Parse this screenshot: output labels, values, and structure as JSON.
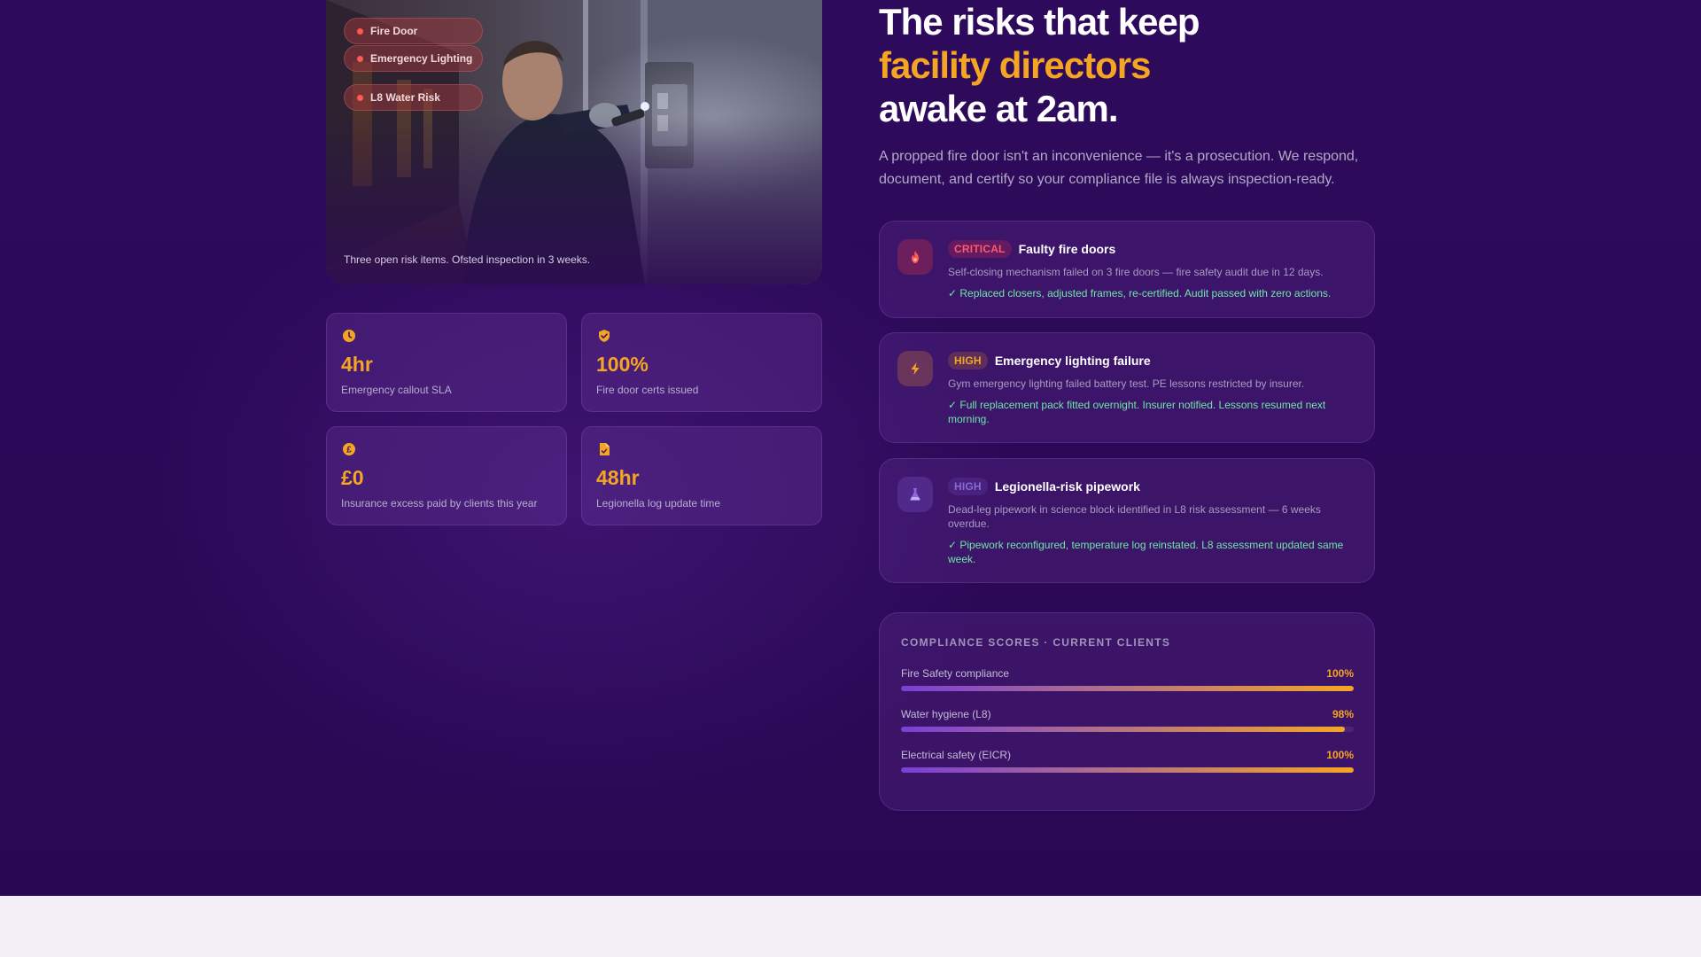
{
  "photo": {
    "tags": [
      "Fire Door",
      "Emergency Lighting",
      "L8 Water Risk"
    ],
    "caption": "Three open risk items. Ofsted inspection in 3 weeks."
  },
  "stats": [
    {
      "icon": "clock-icon",
      "value": "4hr",
      "label": "Emergency callout SLA"
    },
    {
      "icon": "shield-check-icon",
      "value": "100%",
      "label": "Fire door certs issued"
    },
    {
      "icon": "pound-coin-icon",
      "value": "£0",
      "label": "Insurance excess paid by clients this year"
    },
    {
      "icon": "document-icon",
      "value": "48hr",
      "label": "Legionella log update time"
    }
  ],
  "heading": {
    "line1": "The risks that keep",
    "line2": "facility directors",
    "line3": "awake at 2am.",
    "lead": "A propped fire door isn't an inconvenience — it's a prosecution. We respond, document, and certify so your compliance file is always inspection-ready."
  },
  "risks": [
    {
      "icon": "flame-icon",
      "badge": "CRITICAL",
      "title": "Faulty fire doors",
      "description": "Self-closing mechanism failed on 3 fire doors — fire safety audit due in 12 days.",
      "resolution": "✓ Replaced closers, adjusted frames, re-certified. Audit passed with zero actions."
    },
    {
      "icon": "lightning-icon",
      "badge": "HIGH",
      "title": "Emergency lighting failure",
      "description": "Gym emergency lighting failed battery test. PE lessons restricted by insurer.",
      "resolution": "✓ Full replacement pack fitted overnight. Insurer notified. Lessons resumed next morning."
    },
    {
      "icon": "flask-icon",
      "badge": "HIGH",
      "title": "Legionella-risk pipework",
      "description": "Dead-leg pipework in science block identified in L8 risk assessment — 6 weeks overdue.",
      "resolution": "✓ Pipework reconfigured, temperature log reinstated. L8 assessment updated same week."
    }
  ],
  "compliance": {
    "heading": "COMPLIANCE SCORES · CURRENT CLIENTS",
    "rows": [
      {
        "label": "Fire Safety compliance",
        "value": "100%",
        "fraction": 1.0
      },
      {
        "label": "Water hygiene (L8)",
        "value": "98%",
        "fraction": 0.98
      },
      {
        "label": "Electrical safety (EICR)",
        "value": "100%",
        "fraction": 1.0
      }
    ]
  },
  "colors": {
    "background": "#2e0a5c",
    "accent": "#f5a524",
    "critical": "#ff5a52",
    "resolved": "#6ee7a8",
    "footer": "#f2f0f6"
  }
}
